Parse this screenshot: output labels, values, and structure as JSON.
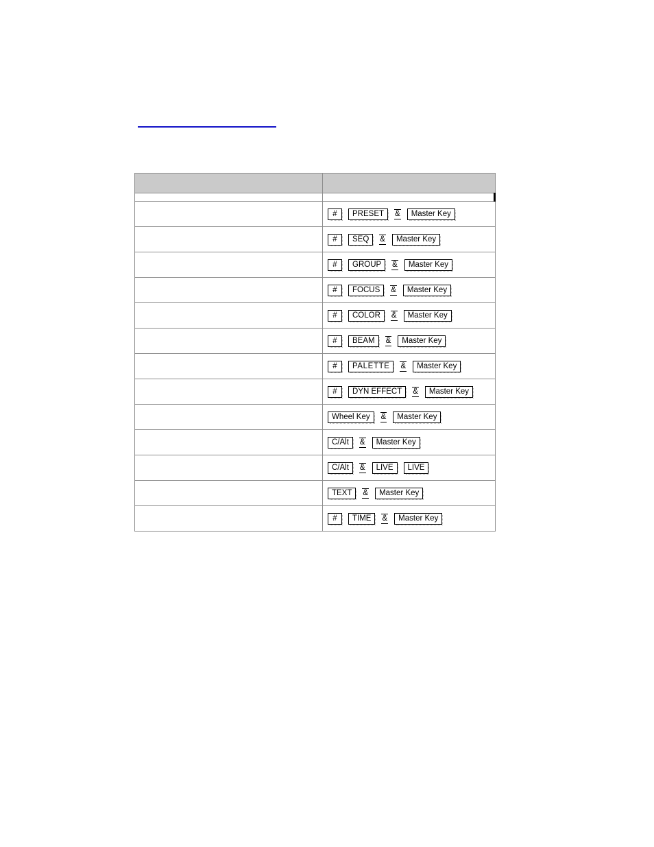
{
  "document": {
    "page_background": "#ffffff",
    "link_color": "#1414c8",
    "header_fill": "#cacaca",
    "border_color": "#8c8c8c"
  },
  "anchor": {
    "label": ""
  },
  "table": {
    "headers": {
      "description": "",
      "key_combination": ""
    },
    "joiner_symbol": "&",
    "rows": [
      {
        "description": "",
        "keys": [
          {
            "type": "cap",
            "label": "#",
            "style": "hash"
          },
          {
            "type": "cap",
            "label": "PRESET",
            "style": "normal"
          },
          {
            "type": "joiner",
            "label": "&"
          },
          {
            "type": "cap",
            "label": "Master Key",
            "style": "normal"
          }
        ]
      },
      {
        "description": "",
        "keys": [
          {
            "type": "cap",
            "label": "#",
            "style": "hash"
          },
          {
            "type": "cap",
            "label": "SEQ",
            "style": "normal"
          },
          {
            "type": "joiner",
            "label": "&"
          },
          {
            "type": "cap",
            "label": "Master Key",
            "style": "normal"
          }
        ]
      },
      {
        "description": "",
        "keys": [
          {
            "type": "cap",
            "label": "#",
            "style": "hash"
          },
          {
            "type": "cap",
            "label": "GROUP",
            "style": "normal"
          },
          {
            "type": "joiner",
            "label": "&"
          },
          {
            "type": "cap",
            "label": "Master Key",
            "style": "normal"
          }
        ]
      },
      {
        "description": "",
        "keys": [
          {
            "type": "cap",
            "label": "#",
            "style": "hash"
          },
          {
            "type": "cap",
            "label": "FOCUS",
            "style": "normal"
          },
          {
            "type": "joiner",
            "label": "&"
          },
          {
            "type": "cap",
            "label": "Master Key",
            "style": "normal"
          }
        ]
      },
      {
        "description": "",
        "keys": [
          {
            "type": "cap",
            "label": "#",
            "style": "hash"
          },
          {
            "type": "cap",
            "label": "COLOR",
            "style": "normal"
          },
          {
            "type": "joiner",
            "label": "&"
          },
          {
            "type": "cap",
            "label": "Master Key",
            "style": "normal"
          }
        ]
      },
      {
        "description": "",
        "keys": [
          {
            "type": "cap",
            "label": "#",
            "style": "hash"
          },
          {
            "type": "cap",
            "label": "BEAM",
            "style": "normal"
          },
          {
            "type": "joiner",
            "label": "&"
          },
          {
            "type": "cap",
            "label": "Master Key",
            "style": "normal"
          }
        ]
      },
      {
        "description": "",
        "keys": [
          {
            "type": "cap",
            "label": "#",
            "style": "hash"
          },
          {
            "type": "cap",
            "label": "PALETTE",
            "style": "wide"
          },
          {
            "type": "joiner",
            "label": "&"
          },
          {
            "type": "cap",
            "label": "Master Key",
            "style": "normal"
          }
        ]
      },
      {
        "description": "",
        "keys": [
          {
            "type": "cap",
            "label": "#",
            "style": "hash"
          },
          {
            "type": "cap",
            "label": "DYN EFFECT",
            "style": "normal"
          },
          {
            "type": "joiner",
            "label": "&"
          },
          {
            "type": "cap",
            "label": "Master Key",
            "style": "normal"
          }
        ]
      },
      {
        "description": "",
        "keys": [
          {
            "type": "cap",
            "label": "Wheel Key",
            "style": "normal"
          },
          {
            "type": "joiner",
            "label": "&"
          },
          {
            "type": "cap",
            "label": "Master Key",
            "style": "normal"
          }
        ]
      },
      {
        "description": "",
        "keys": [
          {
            "type": "cap",
            "label": "C/Alt",
            "style": "normal"
          },
          {
            "type": "joiner",
            "label": "&"
          },
          {
            "type": "cap",
            "label": "Master Key",
            "style": "normal"
          }
        ]
      },
      {
        "description": "",
        "keys": [
          {
            "type": "cap",
            "label": "C/Alt",
            "style": "normal"
          },
          {
            "type": "joiner",
            "label": "&"
          },
          {
            "type": "cap",
            "label": "LIVE",
            "style": "normal"
          },
          {
            "type": "cap",
            "label": "LIVE",
            "style": "normal"
          }
        ]
      },
      {
        "description": "",
        "keys": [
          {
            "type": "cap",
            "label": "TEXT",
            "style": "normal"
          },
          {
            "type": "joiner",
            "label": "&"
          },
          {
            "type": "cap",
            "label": "Master Key",
            "style": "normal"
          }
        ]
      },
      {
        "description": "",
        "keys": [
          {
            "type": "cap",
            "label": "#",
            "style": "hash"
          },
          {
            "type": "cap",
            "label": "TIME",
            "style": "normal"
          },
          {
            "type": "joiner",
            "label": "&"
          },
          {
            "type": "cap",
            "label": "Master Key",
            "style": "normal"
          }
        ]
      }
    ]
  }
}
